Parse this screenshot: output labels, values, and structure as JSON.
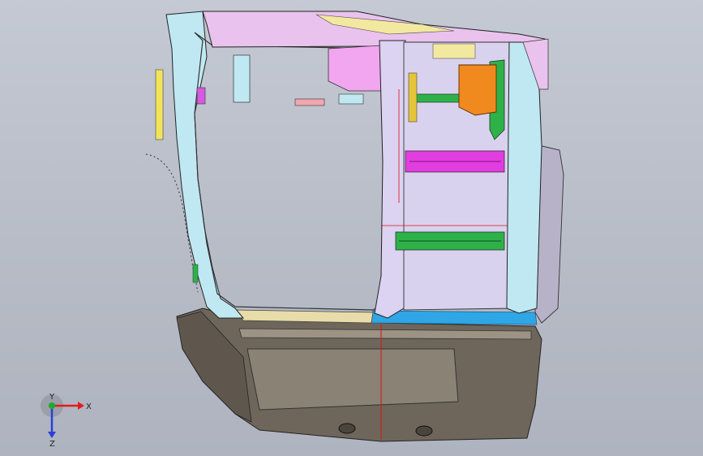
{
  "viewport": {
    "background_top": "#c4c9d3",
    "background_bottom": "#aeb3bf"
  },
  "model": {
    "name_icon": "vehicle-door-assembly",
    "colors": {
      "frame_cyan": "#bfe8f2",
      "pink_panel": "#f3a6f0",
      "magenta_bar": "#e23de0",
      "green_bar": "#2fb14a",
      "orange_bracket": "#f08a1e",
      "yellow_strip": "#f2e35a",
      "lavender": "#dcd2f2",
      "blue_sill": "#2fa6e6",
      "dark_panel": "#6b6359",
      "tan_trim": "#e8d9a8",
      "outline": "#222222",
      "red_line": "#d11"
    }
  },
  "triad": {
    "x_label": "X",
    "y_label": "Y",
    "z_label": "Z",
    "x_color": "#e31b1b",
    "y_color": "#1faa2d",
    "z_color": "#2a3fd8"
  }
}
